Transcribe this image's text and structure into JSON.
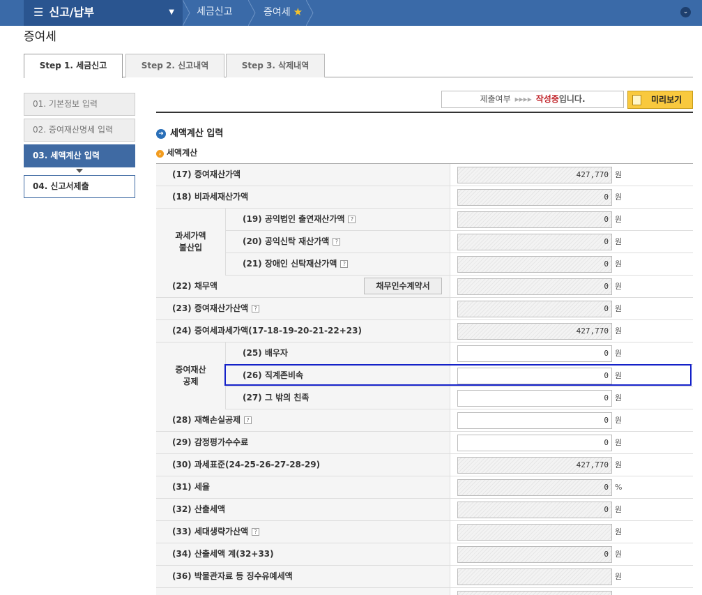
{
  "topbar": {
    "menu_label": "신고/납부",
    "crumb1": "세금신고",
    "crumb2": "증여세"
  },
  "page_title": "증여세",
  "tabs": [
    "Step 1. 세금신고",
    "Step 2. 신고내역",
    "Step 3. 삭제내역"
  ],
  "side_nav": [
    "01. 기본정보 입력",
    "02. 증여재산명세 입력",
    "03. 세액계산 입력",
    "04. 신고서제출"
  ],
  "status": {
    "label": "제출여부",
    "arrows": "▸▸▸▸",
    "state": "작성중",
    "suffix": "입니다."
  },
  "preview_label": "미리보기",
  "section_title": "세액계산 입력",
  "subsection_title": "세액계산",
  "groups": [
    "과세가액\n불산입",
    "증여재산\n공제"
  ],
  "debt_button": "채무인수계약서",
  "rows": [
    {
      "label": "(17) 증여재산가액",
      "value": "427,770",
      "unit": "원"
    },
    {
      "label": "(18) 비과세재산가액",
      "value": "0",
      "unit": "원"
    },
    {
      "label": "(19) 공익법인 출연재산가액",
      "value": "0",
      "unit": "원"
    },
    {
      "label": "(20) 공익신탁 재산가액",
      "value": "0",
      "unit": "원"
    },
    {
      "label": "(21) 장애인 신탁재산가액",
      "value": "0",
      "unit": "원"
    },
    {
      "label": "(22) 채무액",
      "value": "0",
      "unit": "원"
    },
    {
      "label": "(23) 증여재산가산액",
      "value": "0",
      "unit": "원"
    },
    {
      "label": "(24) 증여세과세가액(17-18-19-20-21-22+23)",
      "value": "427,770",
      "unit": "원"
    },
    {
      "label": "(25) 배우자",
      "value": "0",
      "unit": "원"
    },
    {
      "label": "(26) 직계존비속",
      "value": "0",
      "unit": "원"
    },
    {
      "label": "(27) 그 밖의 친족",
      "value": "0",
      "unit": "원"
    },
    {
      "label": "(28) 재해손실공제",
      "value": "0",
      "unit": "원"
    },
    {
      "label": "(29) 감정평가수수료",
      "value": "0",
      "unit": "원"
    },
    {
      "label": "(30) 과세표준(24-25-26-27-28-29)",
      "value": "427,770",
      "unit": "원"
    },
    {
      "label": "(31) 세율",
      "value": "0",
      "unit": "%"
    },
    {
      "label": "(32) 산출세액",
      "value": "0",
      "unit": "원"
    },
    {
      "label": "(33) 세대생략가산액",
      "value": "",
      "unit": "원"
    },
    {
      "label": "(34) 산출세액 계(32+33)",
      "value": "0",
      "unit": "원"
    },
    {
      "label": "(36) 박물관자료 등 징수유예세액",
      "value": "",
      "unit": "원"
    }
  ]
}
